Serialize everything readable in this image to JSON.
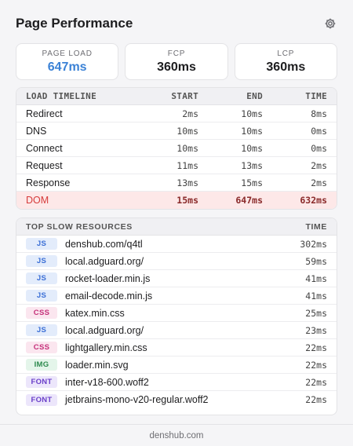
{
  "header": {
    "title": "Page Performance",
    "settings_icon": "gear-icon"
  },
  "metrics": [
    {
      "label": "PAGE LOAD",
      "value": "647ms",
      "accent": "#3b82d6"
    },
    {
      "label": "FCP",
      "value": "360ms"
    },
    {
      "label": "LCP",
      "value": "360ms"
    }
  ],
  "timeline": {
    "headers": {
      "name": "LOAD TIMELINE",
      "start": "START",
      "end": "END",
      "time": "TIME"
    },
    "rows": [
      {
        "name": "Redirect",
        "start": "2ms",
        "end": "10ms",
        "time": "8ms"
      },
      {
        "name": "DNS",
        "start": "10ms",
        "end": "10ms",
        "time": "0ms"
      },
      {
        "name": "Connect",
        "start": "10ms",
        "end": "10ms",
        "time": "0ms"
      },
      {
        "name": "Request",
        "start": "11ms",
        "end": "13ms",
        "time": "2ms"
      },
      {
        "name": "Response",
        "start": "13ms",
        "end": "15ms",
        "time": "2ms"
      },
      {
        "name": "DOM",
        "start": "15ms",
        "end": "647ms",
        "time": "632ms",
        "highlight": true
      }
    ]
  },
  "resources": {
    "headers": {
      "name": "TOP SLOW RESOURCES",
      "time": "TIME"
    },
    "rows": [
      {
        "type": "JS",
        "name": "denshub.com/q4tl",
        "time": "302ms"
      },
      {
        "type": "JS",
        "name": "local.adguard.org/",
        "time": "59ms"
      },
      {
        "type": "JS",
        "name": "rocket-loader.min.js",
        "time": "41ms"
      },
      {
        "type": "JS",
        "name": "email-decode.min.js",
        "time": "41ms"
      },
      {
        "type": "CSS",
        "name": "katex.min.css",
        "time": "25ms"
      },
      {
        "type": "JS",
        "name": "local.adguard.org/",
        "time": "23ms"
      },
      {
        "type": "CSS",
        "name": "lightgallery.min.css",
        "time": "22ms"
      },
      {
        "type": "IMG",
        "name": "loader.min.svg",
        "time": "22ms"
      },
      {
        "type": "FONT",
        "name": "inter-v18-600.woff2",
        "time": "22ms"
      },
      {
        "type": "FONT",
        "name": "jetbrains-mono-v20-regular.woff2",
        "time": "22ms"
      }
    ]
  },
  "footer": {
    "text": "denshub.com"
  }
}
